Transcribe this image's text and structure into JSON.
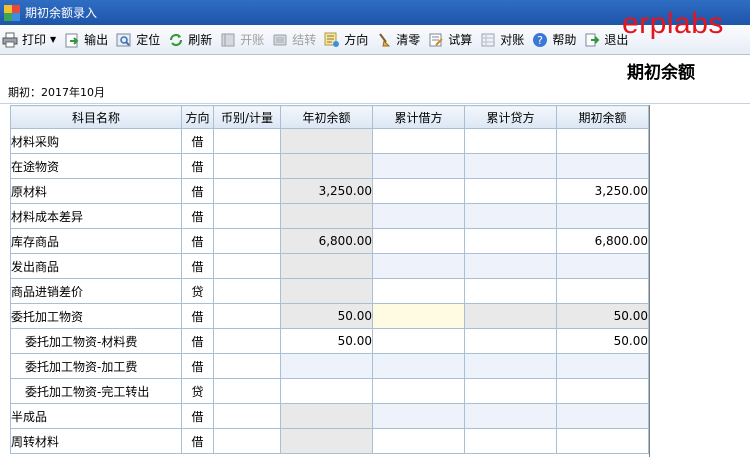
{
  "window": {
    "title": "期初余额录入"
  },
  "brand": "erplabs",
  "toolbar": {
    "print": "打印",
    "export": "输出",
    "locate": "定位",
    "refresh": "刷新",
    "open_account": "开账",
    "carry_over": "结转",
    "direction": "方向",
    "clear_zero": "清零",
    "trial_balance": "试算",
    "reconcile": "对账",
    "help": "帮助",
    "exit": "退出"
  },
  "page": {
    "heading": "期初余额",
    "period": "期初：2017年10月"
  },
  "table": {
    "headers": [
      "科目名称",
      "方向",
      "币别/计量",
      "年初余额",
      "累计借方",
      "累计贷方",
      "期初余额"
    ],
    "rows": [
      {
        "name": "材料采购",
        "dir": "借",
        "currency": "",
        "year_start": "",
        "debit": "",
        "credit": "",
        "opening": ""
      },
      {
        "name": "在途物资",
        "dir": "借",
        "currency": "",
        "year_start": "",
        "debit": "",
        "credit": "",
        "opening": ""
      },
      {
        "name": "原材料",
        "dir": "借",
        "currency": "",
        "year_start": "3,250.00",
        "debit": "",
        "credit": "",
        "opening": "3,250.00"
      },
      {
        "name": "材料成本差异",
        "dir": "借",
        "currency": "",
        "year_start": "",
        "debit": "",
        "credit": "",
        "opening": ""
      },
      {
        "name": "库存商品",
        "dir": "借",
        "currency": "",
        "year_start": "6,800.00",
        "debit": "",
        "credit": "",
        "opening": "6,800.00"
      },
      {
        "name": "发出商品",
        "dir": "借",
        "currency": "",
        "year_start": "",
        "debit": "",
        "credit": "",
        "opening": ""
      },
      {
        "name": "商品进销差价",
        "dir": "贷",
        "currency": "",
        "year_start": "",
        "debit": "",
        "credit": "",
        "opening": ""
      },
      {
        "name": "委托加工物资",
        "dir": "借",
        "currency": "",
        "year_start": "50.00",
        "debit": "",
        "credit": "",
        "opening": "50.00"
      },
      {
        "name": "委托加工物资-材料费",
        "dir": "借",
        "currency": "",
        "year_start": "50.00",
        "debit": "",
        "credit": "",
        "opening": "50.00"
      },
      {
        "name": "委托加工物资-加工费",
        "dir": "借",
        "currency": "",
        "year_start": "",
        "debit": "",
        "credit": "",
        "opening": ""
      },
      {
        "name": "委托加工物资-完工转出",
        "dir": "贷",
        "currency": "",
        "year_start": "",
        "debit": "",
        "credit": "",
        "opening": ""
      },
      {
        "name": "半成品",
        "dir": "借",
        "currency": "",
        "year_start": "",
        "debit": "",
        "credit": "",
        "opening": ""
      },
      {
        "name": "周转材料",
        "dir": "借",
        "currency": "",
        "year_start": "",
        "debit": "",
        "credit": "",
        "opening": ""
      }
    ]
  },
  "colors": {
    "titlebar": "#1d55a8",
    "brand": "#e4161c",
    "grid_border": "#a9bfd6",
    "readonly_cell": "#e9e9e9",
    "alt_cell": "#eef3fb",
    "focus_cell": "#fffbe3"
  }
}
